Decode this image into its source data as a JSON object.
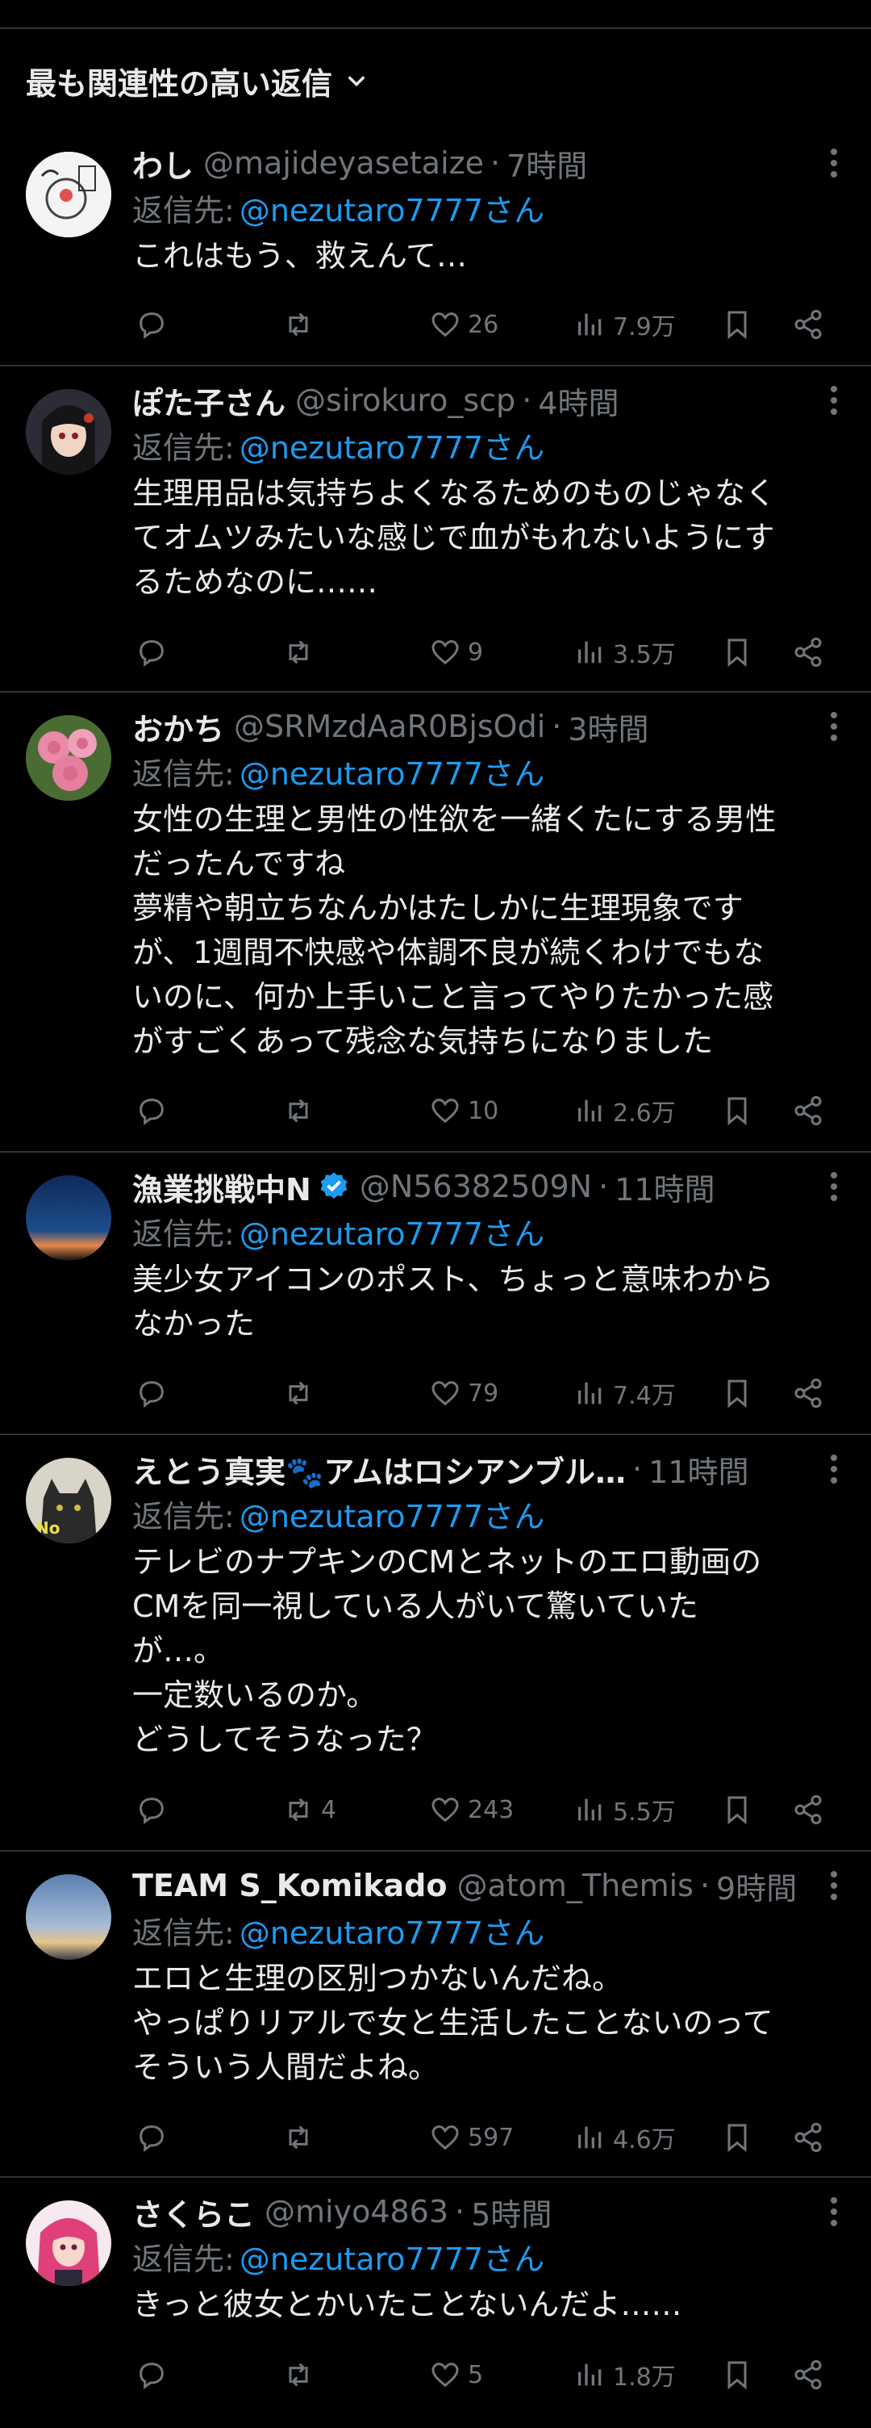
{
  "header": {
    "sort_label": "最も関連性の高い返信"
  },
  "reply_prefix": "返信先:",
  "posts": [
    {
      "name": "わし",
      "handle": "@majideyasetaize",
      "time": "7時間",
      "mention": "@nezutaro7777さん",
      "text": "これはもう、救えんて…",
      "replies": "",
      "reposts": "",
      "likes": "26",
      "views": "7.9万"
    },
    {
      "name": "ぽた子さん",
      "handle": "@sirokuro_scp",
      "time": "4時間",
      "mention": "@nezutaro7777さん",
      "text": "生理用品は気持ちよくなるためのものじゃなく\nてオムツみたいな感じで血がもれないようにす\nるためなのに……",
      "replies": "",
      "reposts": "",
      "likes": "9",
      "views": "3.5万"
    },
    {
      "name": "おかち",
      "handle": "@SRMzdAaR0BjsOdi",
      "time": "3時間",
      "mention": "@nezutaro7777さん",
      "text": "女性の生理と男性の性欲を一緒くたにする男性\nだったんですね\n夢精や朝立ちなんかはたしかに生理現象です\nが、1週間不快感や体調不良が続くわけでもな\nいのに、何か上手いこと言ってやりたかった感\nがすごくあって残念な気持ちになりました",
      "replies": "",
      "reposts": "",
      "likes": "10",
      "views": "2.6万"
    },
    {
      "name": "漁業挑戦中N",
      "handle": "@N56382509N",
      "time": "11時間",
      "mention": "@nezutaro7777さん",
      "text": "美少女アイコンのポスト、ちょっと意味わから\nなかった",
      "replies": "",
      "reposts": "",
      "likes": "79",
      "views": "7.4万"
    },
    {
      "name": "えとう真実🐾アムはロシアンブル…",
      "handle": "",
      "time": "11時間",
      "mention": "@nezutaro7777さん",
      "text": "テレビのナプキンのCMとネットのエロ動画の\nCMを同一視している人がいて驚いていた\nが…。\n一定数いるのか。\nどうしてそうなった？",
      "replies": "",
      "reposts": "4",
      "likes": "243",
      "views": "5.5万"
    },
    {
      "name": "TEAM S_Komikado",
      "handle": "@atom_Themis",
      "time": "9時間",
      "mention": "@nezutaro7777さん",
      "text": "エロと生理の区別つかないんだね。\nやっぱりリアルで女と生活したことないのって\nそういう人間だよね。",
      "replies": "",
      "reposts": "",
      "likes": "597",
      "views": "4.6万"
    },
    {
      "name": "さくらこ",
      "handle": "@miyo4863",
      "time": "5時間",
      "mention": "@nezutaro7777さん",
      "text": "きっと彼女とかいたことないんだよ……",
      "replies": "",
      "reposts": "",
      "likes": "5",
      "views": "1.8万"
    }
  ],
  "colors": {
    "background": "#000000",
    "text": "#e7e9ea",
    "secondary": "#71767b",
    "mention": "#1d9bf0",
    "divider": "#2f3336",
    "verified": "#1d9bf0"
  },
  "icons": [
    "chevron-down-icon",
    "more-icon",
    "reply-icon",
    "repost-icon",
    "like-icon",
    "views-icon",
    "bookmark-icon",
    "share-icon",
    "verified-badge-icon"
  ]
}
